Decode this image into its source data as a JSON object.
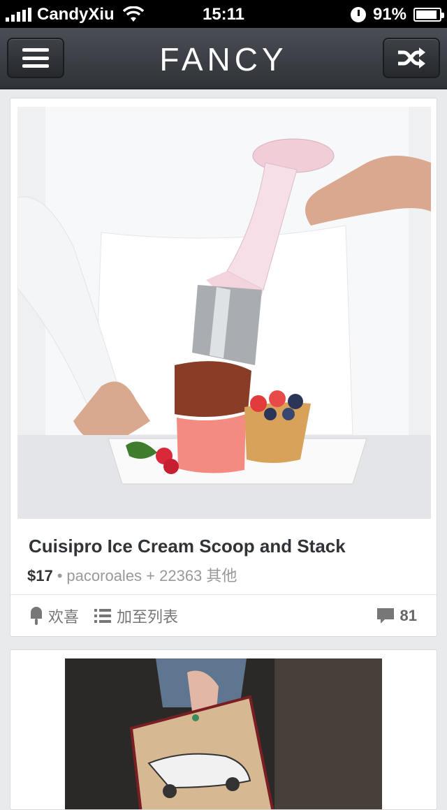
{
  "status_bar": {
    "carrier": "CandyXiu",
    "time": "15:11",
    "battery_percent": "91%",
    "battery_level": 0.91
  },
  "nav": {
    "title": "FANCY",
    "menu_icon": "hamburger-menu-icon",
    "shuffle_icon": "shuffle-icon"
  },
  "feed": {
    "items": [
      {
        "title": "Cuisipro Ice Cream Scoop and Stack",
        "price": "$17",
        "separator": "•",
        "byline": "pacoroales + 22363 其他",
        "fancy_label": "欢喜",
        "add_list_label": "加至列表",
        "comments_count": "81"
      }
    ]
  },
  "colors": {
    "navbar": "#3a3d42",
    "background": "#e9eaec",
    "title_text": "#303338"
  }
}
